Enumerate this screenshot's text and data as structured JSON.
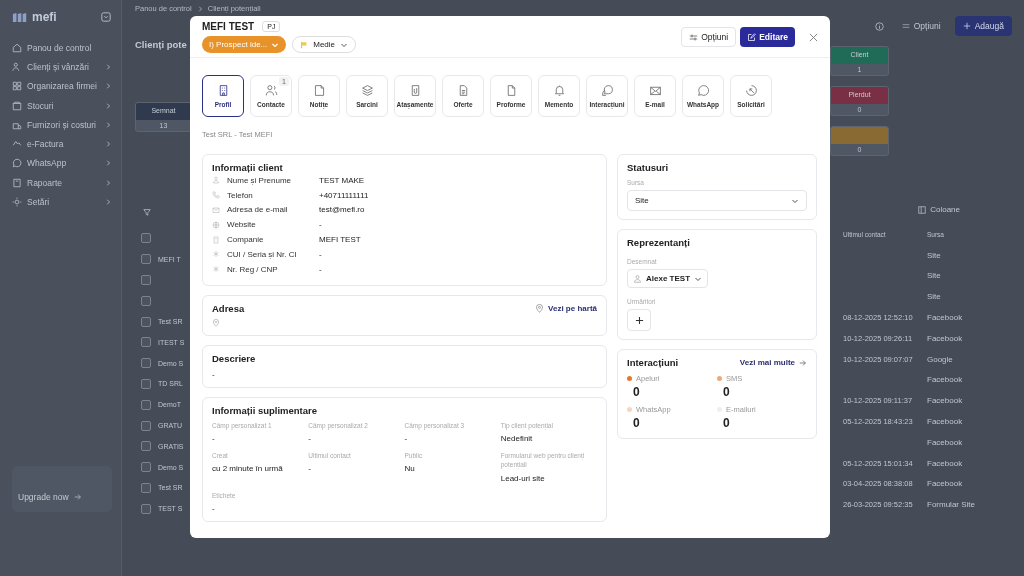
{
  "sidebar": {
    "logo": "mefi",
    "items": [
      {
        "label": "Panou de control",
        "expandable": false
      },
      {
        "label": "Clienți și vânzări",
        "expandable": true
      },
      {
        "label": "Organizarea firmei",
        "expandable": true
      },
      {
        "label": "Stocuri",
        "expandable": true
      },
      {
        "label": "Furnizori și costuri",
        "expandable": true
      },
      {
        "label": "e-Factura",
        "expandable": true
      },
      {
        "label": "WhatsApp",
        "expandable": true
      },
      {
        "label": "Rapoarte",
        "expandable": true
      },
      {
        "label": "Setări",
        "expandable": true
      }
    ],
    "upgrade": "Upgrade now"
  },
  "page": {
    "breadcrumb": [
      "Panou de control",
      "Clienți potențiali"
    ],
    "title": "Clienți pote",
    "options_button": "Opțiuni",
    "add_button": "Adaugă",
    "columns_button": "Coloane",
    "left_cards": [
      {
        "label": "Semnat",
        "count": "13",
        "color": "#2f3a4f"
      }
    ],
    "right_cards": [
      {
        "label": "Client",
        "count": "1",
        "color": "#1f6b58"
      },
      {
        "label": "Pierdut",
        "count": "0",
        "color": "#7a3044"
      },
      {
        "count": "0",
        "color": "#8a6a33"
      }
    ],
    "table": {
      "columns": [
        "Ultimul contact",
        "Sursa"
      ],
      "all_checked": false,
      "rows": [
        {
          "name": "MEFI T",
          "last_contact": "",
          "source": "Site",
          "checked": false
        },
        {
          "name": "",
          "last_contact": "",
          "source": "Site",
          "checked": false
        },
        {
          "name": "",
          "last_contact": "",
          "source": "Site",
          "checked": false
        },
        {
          "name": "Test SR",
          "last_contact": "08-12-2025 12:52:10",
          "source": "Facebook",
          "checked": false
        },
        {
          "name": "ITEST S",
          "last_contact": "10-12-2025 09:26:11",
          "source": "Facebook",
          "checked": false
        },
        {
          "name": "Demo S",
          "last_contact": "10-12-2025 09:07:07",
          "source": "Google",
          "checked": false
        },
        {
          "name": "TD SRL",
          "last_contact": "",
          "source": "Facebook",
          "checked": false
        },
        {
          "name": "DemoT",
          "last_contact": "10-12-2025 09:11:37",
          "source": "Facebook",
          "checked": false
        },
        {
          "name": "GRATU",
          "last_contact": "05-12-2025 18:43:23",
          "source": "Facebook",
          "checked": false
        },
        {
          "name": "GRATIS",
          "last_contact": "",
          "source": "Facebook",
          "checked": false
        },
        {
          "name": "Demo S",
          "last_contact": "05-12-2025 15:01:34",
          "source": "Facebook",
          "checked": false
        },
        {
          "name": "Test SR",
          "last_contact": "03-04-2025 08:38:08",
          "source": "Facebook",
          "checked": false
        },
        {
          "name": "TEST S",
          "last_contact": "26-03-2025 09:52:35",
          "source": "Formular Site",
          "checked": false
        }
      ]
    }
  },
  "modal": {
    "title": "MEFI TEST",
    "type_badge": "PJ",
    "status": "I) Prospect ide...",
    "priority": "Medie",
    "options_button": "Opțiuni",
    "edit_button": "Editare",
    "tabs": [
      {
        "label": "Profil",
        "selected": true
      },
      {
        "label": "Contacte",
        "selected": false,
        "badge": "1"
      },
      {
        "label": "Notițe",
        "selected": false
      },
      {
        "label": "Sarcini",
        "selected": false
      },
      {
        "label": "Atașamente",
        "selected": false
      },
      {
        "label": "Oferte",
        "selected": false
      },
      {
        "label": "Proforme",
        "selected": false
      },
      {
        "label": "Memento",
        "selected": false
      },
      {
        "label": "Interacțiuni",
        "selected": false
      },
      {
        "label": "E-mail",
        "selected": false
      },
      {
        "label": "WhatsApp",
        "selected": false
      },
      {
        "label": "Solicitări",
        "selected": false
      }
    ],
    "subtitle": "Test SRL - Test MEFI",
    "client_info": {
      "title": "Informații client",
      "rows": [
        {
          "label": "Nume și Prenume",
          "value": "TEST MAKE"
        },
        {
          "label": "Telefon",
          "value": "+40711111111"
        },
        {
          "label": "Adresa de e-mail",
          "value": "test@mefi.ro"
        },
        {
          "label": "Website",
          "value": "-"
        },
        {
          "label": "Companie",
          "value": "MEFI TEST"
        },
        {
          "label": "CUI / Seria și Nr. CI",
          "value": "-"
        },
        {
          "label": "Nr. Reg / CNP",
          "value": "-"
        }
      ]
    },
    "address": {
      "title": "Adresa",
      "map_link": "Vezi pe hartă"
    },
    "description": {
      "title": "Descriere",
      "value": "-"
    },
    "extra_info": {
      "title": "Informații suplimentare",
      "fields": [
        {
          "label": "Câmp personalizat 1",
          "value": "-"
        },
        {
          "label": "Câmp personalizat 2",
          "value": "-"
        },
        {
          "label": "Câmp personalizat 3",
          "value": "-"
        },
        {
          "label": "Tip client potențial",
          "value": "Nedefinit"
        },
        {
          "label": "Creat",
          "value": "cu 2 minute în urmă"
        },
        {
          "label": "Ultimul contact",
          "value": "-"
        },
        {
          "label": "Public",
          "value": "Nu"
        },
        {
          "label": "Formularul web pentru clienți potențiali",
          "value": "Lead-uri site"
        },
        {
          "label": "Etichete",
          "value": "-"
        }
      ]
    },
    "statuses": {
      "title": "Statusuri",
      "source_label": "Sursa",
      "source_value": "Site"
    },
    "representatives": {
      "title": "Reprezentanți",
      "assigned_label": "Desemnat",
      "assigned": "Alexe TEST",
      "followers_label": "Urmăritori"
    },
    "interactions": {
      "title": "Interacțiuni",
      "more_link": "Vezi mai multe",
      "stats": [
        {
          "label": "Apeluri",
          "value": "0",
          "color": "#e8772e"
        },
        {
          "label": "SMS",
          "value": "0",
          "color": "#f0a878"
        },
        {
          "label": "WhatsApp",
          "value": "0",
          "color": "#f8d5bc"
        },
        {
          "label": "E-mailuri",
          "value": "0",
          "color": "#efefef"
        }
      ]
    }
  }
}
